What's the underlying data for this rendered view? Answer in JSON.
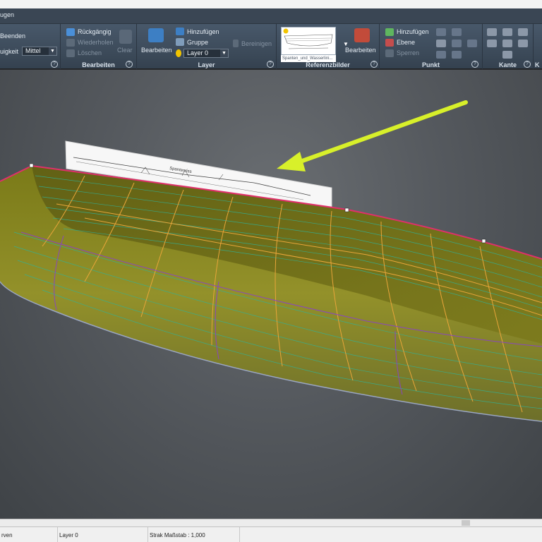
{
  "window": {
    "tab_fragment": "ugen"
  },
  "ribbon": {
    "panel_left": {
      "finish_label": "Beenden",
      "precision_label": "uigkeit",
      "precision_value": "Mittel"
    },
    "edit": {
      "title": "Bearbeiten",
      "undo_label": "Rückgängig",
      "redo_label": "Wiederholen",
      "delete_label": "Löschen",
      "clear_label": "Clear"
    },
    "layer": {
      "title": "Layer",
      "edit_label": "Bearbeiten",
      "add_label": "Hinzufügen",
      "group_label": "Gruppe",
      "current_layer": "Layer 0",
      "cleanup_label": "Bereinigen"
    },
    "reference": {
      "title": "Referenzbilder",
      "image_caption": "Spanten_und_Wasserlini...",
      "edit_label": "Bearbeiten"
    },
    "point": {
      "title": "Punkt",
      "add_label": "Hinzufügen",
      "plane_label": "Ebene",
      "lock_label": "Sperren"
    },
    "edge": {
      "title": "Kante"
    },
    "cut_fragment": "K"
  },
  "viewport": {
    "reference_image_label": "Spantenriss",
    "colors": {
      "hull_fill": "#8a8a1e",
      "frame_lines": "#e8a53a",
      "water_lines": "#2fb39a",
      "sheer_line": "#e0306a",
      "arrow": "#d8f02a"
    }
  },
  "statusbar": {
    "curves_label": "rven",
    "layer_label": "Layer 0",
    "scale_label": "Strak Maßstab : 1,000"
  }
}
